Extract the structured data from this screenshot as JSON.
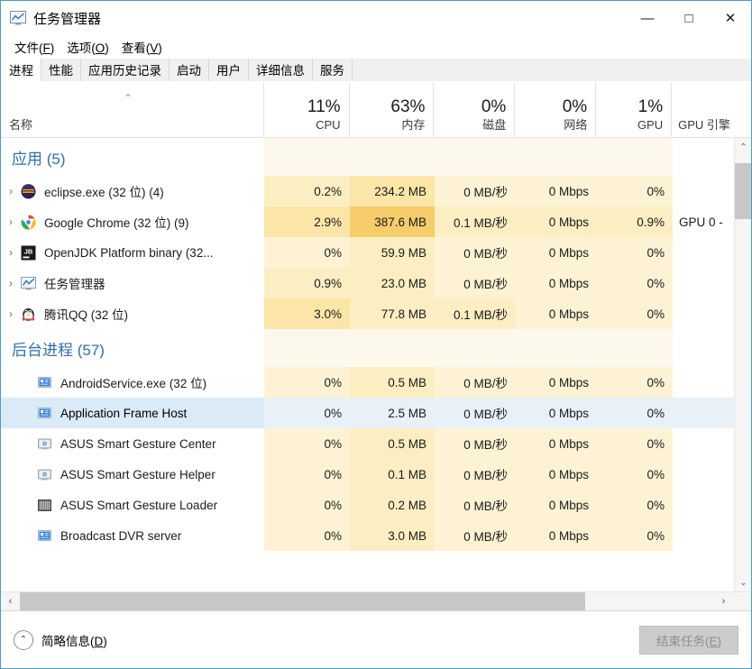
{
  "window": {
    "title": "任务管理器",
    "icon": "task-manager-icon",
    "controls": {
      "minimize": "—",
      "maximize": "□",
      "close": "✕"
    }
  },
  "menu": [
    {
      "label": "文件(F)",
      "text": "文件",
      "accel": "F"
    },
    {
      "label": "选项(O)",
      "text": "选项",
      "accel": "O"
    },
    {
      "label": "查看(V)",
      "text": "查看",
      "accel": "V"
    }
  ],
  "tabs": [
    {
      "label": "进程",
      "active": true
    },
    {
      "label": "性能",
      "active": false
    },
    {
      "label": "应用历史记录",
      "active": false
    },
    {
      "label": "启动",
      "active": false
    },
    {
      "label": "用户",
      "active": false
    },
    {
      "label": "详细信息",
      "active": false
    },
    {
      "label": "服务",
      "active": false
    }
  ],
  "columns": {
    "name": {
      "label": "名称",
      "percent": "",
      "sort": "ascending",
      "sort_glyph": "⌃"
    },
    "cpu": {
      "label": "CPU",
      "percent": "11%"
    },
    "memory": {
      "label": "内存",
      "percent": "63%"
    },
    "disk": {
      "label": "磁盘",
      "percent": "0%"
    },
    "network": {
      "label": "网络",
      "percent": "0%"
    },
    "gpu": {
      "label": "GPU",
      "percent": "1%"
    },
    "gpu_engine": {
      "label": "GPU 引擎",
      "percent": ""
    }
  },
  "sections": [
    {
      "title": "应用 (5)",
      "name": "apps-section",
      "rows": [
        {
          "name": "eclipse.exe (32 位) (4)",
          "icon": "eclipse-icon",
          "expandable": true,
          "cpu": "0.2%",
          "memory": "234.2 MB",
          "disk": "0 MB/秒",
          "network": "0 Mbps",
          "gpu": "0%",
          "gpu_engine": "",
          "tint_cpu": "t-l2",
          "tint_mem": "t-l3",
          "tint_disk": "t-l1",
          "tint_net": "t-l1",
          "tint_gpu": "t-l1",
          "selected": false
        },
        {
          "name": "Google Chrome (32 位) (9)",
          "icon": "chrome-icon",
          "expandable": true,
          "cpu": "2.9%",
          "memory": "387.6 MB",
          "disk": "0.1 MB/秒",
          "network": "0 Mbps",
          "gpu": "0.9%",
          "gpu_engine": "GPU 0 -",
          "tint_cpu": "t-l3",
          "tint_mem": "t-l5",
          "tint_disk": "t-l2",
          "tint_net": "t-l2",
          "tint_gpu": "t-l2",
          "selected": false
        },
        {
          "name": "OpenJDK Platform binary (32...",
          "icon": "jetbrains-icon",
          "expandable": true,
          "cpu": "0%",
          "memory": "59.9 MB",
          "disk": "0 MB/秒",
          "network": "0 Mbps",
          "gpu": "0%",
          "gpu_engine": "",
          "tint_cpu": "t-l1",
          "tint_mem": "t-l2",
          "tint_disk": "t-l1",
          "tint_net": "t-l1",
          "tint_gpu": "t-l1",
          "selected": false
        },
        {
          "name": "任务管理器",
          "icon": "task-manager-icon",
          "expandable": true,
          "cpu": "0.9%",
          "memory": "23.0 MB",
          "disk": "0 MB/秒",
          "network": "0 Mbps",
          "gpu": "0%",
          "gpu_engine": "",
          "tint_cpu": "t-l2",
          "tint_mem": "t-l2",
          "tint_disk": "t-l1",
          "tint_net": "t-l1",
          "tint_gpu": "t-l1",
          "selected": false
        },
        {
          "name": "腾讯QQ (32 位)",
          "icon": "qq-icon",
          "expandable": true,
          "cpu": "3.0%",
          "memory": "77.8 MB",
          "disk": "0.1 MB/秒",
          "network": "0 Mbps",
          "gpu": "0%",
          "gpu_engine": "",
          "tint_cpu": "t-l3",
          "tint_mem": "t-l2",
          "tint_disk": "t-l2",
          "tint_net": "t-l1",
          "tint_gpu": "t-l1",
          "selected": false
        }
      ]
    },
    {
      "title": "后台进程 (57)",
      "name": "background-processes-section",
      "rows": [
        {
          "name": "AndroidService.exe (32 位)",
          "icon": "generic-app-icon",
          "expandable": false,
          "cpu": "0%",
          "memory": "0.5 MB",
          "disk": "0 MB/秒",
          "network": "0 Mbps",
          "gpu": "0%",
          "gpu_engine": "",
          "tint_cpu": "t-l1",
          "tint_mem": "t-l2",
          "tint_disk": "t-l1",
          "tint_net": "t-l1",
          "tint_gpu": "t-l1",
          "selected": false
        },
        {
          "name": "Application Frame Host",
          "icon": "generic-app-icon",
          "expandable": false,
          "cpu": "0%",
          "memory": "2.5 MB",
          "disk": "0 MB/秒",
          "network": "0 Mbps",
          "gpu": "0%",
          "gpu_engine": "",
          "tint_cpu": "t-sel",
          "tint_mem": "t-sel",
          "tint_disk": "t-sel",
          "tint_net": "t-sel",
          "tint_gpu": "t-sel",
          "selected": true
        },
        {
          "name": "ASUS Smart Gesture Center",
          "icon": "asus-gesture-icon",
          "expandable": false,
          "cpu": "0%",
          "memory": "0.5 MB",
          "disk": "0 MB/秒",
          "network": "0 Mbps",
          "gpu": "0%",
          "gpu_engine": "",
          "tint_cpu": "t-l1",
          "tint_mem": "t-l2",
          "tint_disk": "t-l1",
          "tint_net": "t-l1",
          "tint_gpu": "t-l1",
          "selected": false
        },
        {
          "name": "ASUS Smart Gesture Helper",
          "icon": "asus-gesture-icon",
          "expandable": false,
          "cpu": "0%",
          "memory": "0.1 MB",
          "disk": "0 MB/秒",
          "network": "0 Mbps",
          "gpu": "0%",
          "gpu_engine": "",
          "tint_cpu": "t-l1",
          "tint_mem": "t-l2",
          "tint_disk": "t-l1",
          "tint_net": "t-l1",
          "tint_gpu": "t-l1",
          "selected": false
        },
        {
          "name": "ASUS Smart Gesture Loader",
          "icon": "asus-loader-icon",
          "expandable": false,
          "cpu": "0%",
          "memory": "0.2 MB",
          "disk": "0 MB/秒",
          "network": "0 Mbps",
          "gpu": "0%",
          "gpu_engine": "",
          "tint_cpu": "t-l1",
          "tint_mem": "t-l2",
          "tint_disk": "t-l1",
          "tint_net": "t-l1",
          "tint_gpu": "t-l1",
          "selected": false
        },
        {
          "name": "Broadcast DVR server",
          "icon": "generic-app-icon",
          "expandable": false,
          "cpu": "0%",
          "memory": "3.0 MB",
          "disk": "0 MB/秒",
          "network": "0 Mbps",
          "gpu": "0%",
          "gpu_engine": "",
          "tint_cpu": "t-l1",
          "tint_mem": "t-l2",
          "tint_disk": "t-l1",
          "tint_net": "t-l1",
          "tint_gpu": "t-l1",
          "selected": false
        }
      ]
    }
  ],
  "footer": {
    "fewer_details": "简略信息(D)",
    "fewer_details_text": "简略信息",
    "fewer_details_accel": "D",
    "fewer_details_icon": "chevron-up-circle-icon",
    "end_task": "结束任务(E)",
    "end_task_text": "结束任务",
    "end_task_accel": "E",
    "end_task_disabled": true
  },
  "scrollbars": {
    "vertical": {
      "up": "⌃",
      "down": "⌄"
    },
    "horizontal": {
      "left": "‹",
      "right": "›"
    }
  },
  "colors": {
    "window_border": "#4a9ec4",
    "section_header": "#2f6fa8",
    "selection": "#dbeaf7",
    "heat_low": "#fdf3d4",
    "heat_high": "#f7cc6b"
  },
  "expander_glyph": "›"
}
